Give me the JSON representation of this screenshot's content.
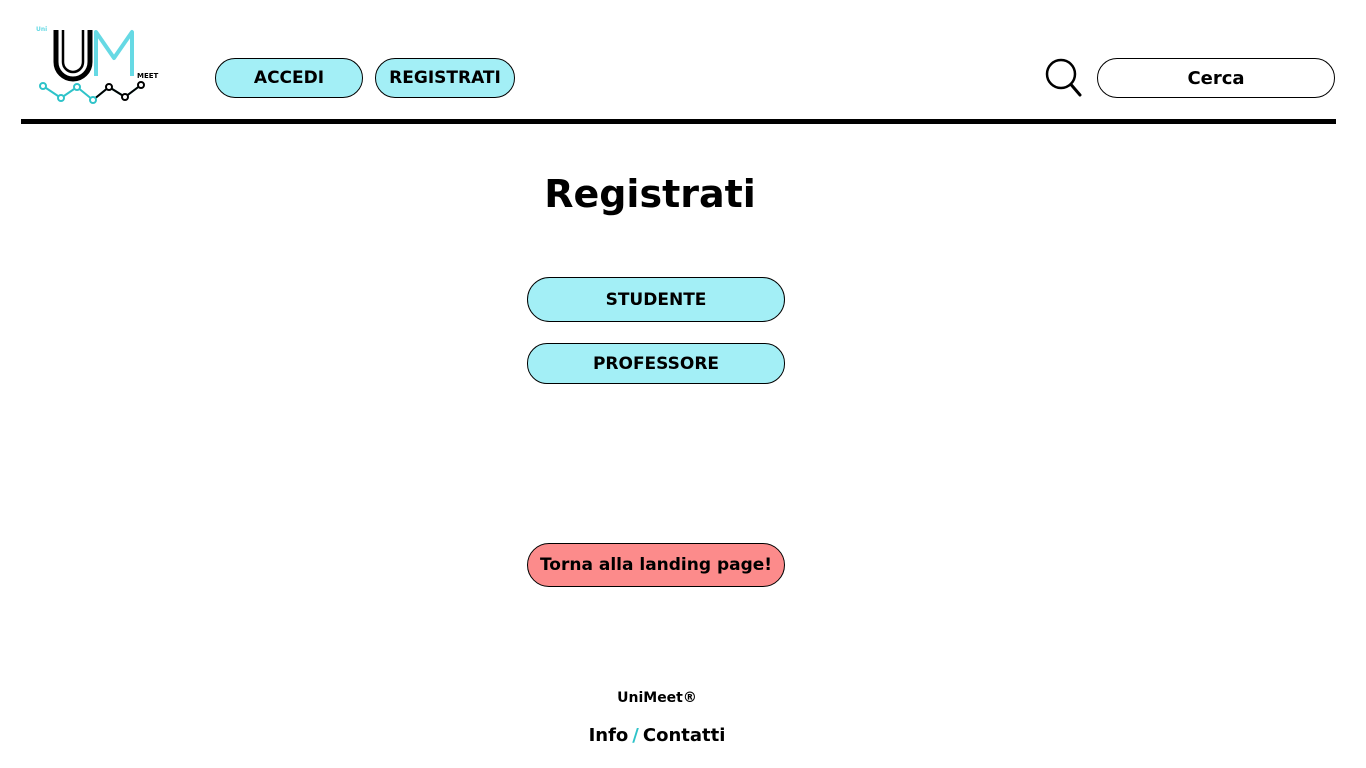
{
  "logo": {
    "name": "UniMeet logo",
    "small_text_left": "Uni",
    "small_text_right": "MEET",
    "letters": "UM"
  },
  "nav": {
    "accedi_label": "ACCEDI",
    "registrati_label": "REGISTRATI"
  },
  "search": {
    "icon": "search-icon",
    "label": "Cerca"
  },
  "main": {
    "title": "Registrati",
    "studente_label": "STUDENTE",
    "professore_label": "PROFESSORE",
    "back_label": "Torna alla landing page!"
  },
  "footer": {
    "brand": "UniMeet®",
    "info_label": "Info",
    "separator": "/",
    "contatti_label": "Contatti"
  },
  "colors": {
    "accent": "#a3eff6",
    "back_button": "#fc8b8b",
    "separator": "#2fc3c9",
    "logo_accent": "#66d9e4"
  }
}
